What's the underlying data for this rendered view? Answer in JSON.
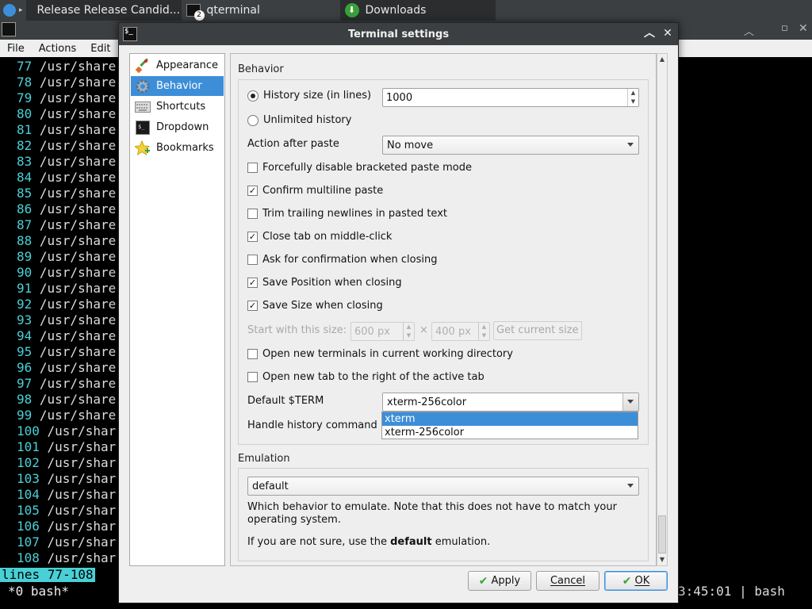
{
  "taskbar": {
    "tasks": [
      {
        "label": "Release Release Candid...",
        "icon": "firefox-icon"
      },
      {
        "label": "qterminal",
        "icon": "terminal-icon",
        "badge": "2"
      },
      {
        "label": "Downloads",
        "icon": "download-icon"
      }
    ]
  },
  "terminal": {
    "menu": [
      "File",
      "Actions",
      "Edit"
    ],
    "lines": [
      {
        "num": "77",
        "text": " /usr/share"
      },
      {
        "num": "78",
        "text": " /usr/share"
      },
      {
        "num": "79",
        "text": " /usr/share"
      },
      {
        "num": "80",
        "text": " /usr/share"
      },
      {
        "num": "81",
        "text": " /usr/share"
      },
      {
        "num": "82",
        "text": " /usr/share"
      },
      {
        "num": "83",
        "text": " /usr/share"
      },
      {
        "num": "84",
        "text": " /usr/share"
      },
      {
        "num": "85",
        "text": " /usr/share"
      },
      {
        "num": "86",
        "text": " /usr/share"
      },
      {
        "num": "87",
        "text": " /usr/share"
      },
      {
        "num": "88",
        "text": " /usr/share"
      },
      {
        "num": "89",
        "text": " /usr/share"
      },
      {
        "num": "90",
        "text": " /usr/share"
      },
      {
        "num": "91",
        "text": " /usr/share"
      },
      {
        "num": "92",
        "text": " /usr/share"
      },
      {
        "num": "93",
        "text": " /usr/share"
      },
      {
        "num": "94",
        "text": " /usr/share"
      },
      {
        "num": "95",
        "text": " /usr/share"
      },
      {
        "num": "96",
        "text": " /usr/share"
      },
      {
        "num": "97",
        "text": " /usr/share"
      },
      {
        "num": "98",
        "text": " /usr/share"
      },
      {
        "num": "99",
        "text": " /usr/share"
      },
      {
        "num": "100",
        "text": " /usr/shar"
      },
      {
        "num": "101",
        "text": " /usr/shar"
      },
      {
        "num": "102",
        "text": " /usr/shar"
      },
      {
        "num": "103",
        "text": " /usr/shar"
      },
      {
        "num": "104",
        "text": " /usr/shar"
      },
      {
        "num": "105",
        "text": " /usr/shar"
      },
      {
        "num": "106",
        "text": " /usr/shar"
      },
      {
        "num": "107",
        "text": " /usr/shar"
      },
      {
        "num": "108",
        "text": " /usr/shar"
      }
    ],
    "status": "lines 77-108",
    "tmux_left": "*0 bash*",
    "tmux_right": "3:45:01 | bash"
  },
  "dialog": {
    "title": "Terminal settings",
    "sidebar": [
      {
        "label": "Appearance",
        "icon": "paintbrush-icon"
      },
      {
        "label": "Behavior",
        "icon": "gear-icon",
        "selected": true
      },
      {
        "label": "Shortcuts",
        "icon": "keyboard-icon"
      },
      {
        "label": "Dropdown",
        "icon": "terminal-icon"
      },
      {
        "label": "Bookmarks",
        "icon": "star-icon"
      }
    ],
    "behavior": {
      "section_title": "Behavior",
      "history_size_label": "History size (in lines)",
      "history_size_value": "1000",
      "unlimited_history_label": "Unlimited history",
      "action_after_paste_label": "Action after paste",
      "action_after_paste_value": "No move",
      "checkboxes": [
        {
          "label": "Forcefully disable bracketed paste mode",
          "checked": false
        },
        {
          "label": "Confirm multiline paste",
          "checked": true
        },
        {
          "label": "Trim trailing newlines in pasted text",
          "checked": false
        },
        {
          "label": "Close tab on middle-click",
          "checked": true
        },
        {
          "label": "Ask for confirmation when closing",
          "checked": false
        },
        {
          "label": "Save Position when closing",
          "checked": true
        },
        {
          "label": "Save Size when closing",
          "checked": true
        }
      ],
      "start_size_label": "Start with this size:",
      "start_width": "600 px",
      "times_sign": "×",
      "start_height": "400 px",
      "get_current_size": "Get current size",
      "checkboxes2": [
        {
          "label": "Open new terminals in current working directory",
          "checked": false
        },
        {
          "label": "Open new tab to the right of the active tab",
          "checked": false
        }
      ],
      "default_term_label": "Default $TERM",
      "default_term_value": "xterm-256color",
      "term_options": [
        "xterm",
        "xterm-256color"
      ],
      "handle_history_label": "Handle history command"
    },
    "emulation": {
      "section_title": "Emulation",
      "value": "default",
      "desc1": "Which behavior to emulate. Note that this does not have to match your operating system.",
      "desc2_pre": "If you are not sure, use the ",
      "desc2_bold": "default",
      "desc2_post": " emulation."
    },
    "buttons": {
      "apply": "Apply",
      "cancel": "Cancel",
      "ok": "OK"
    }
  }
}
